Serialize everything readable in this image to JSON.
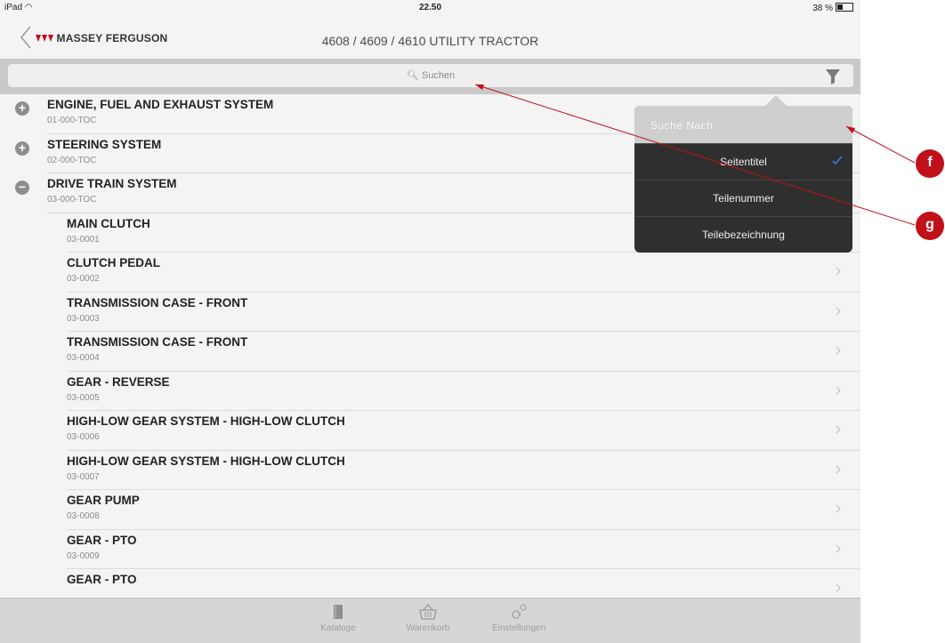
{
  "status_bar": {
    "device": "iPad",
    "time": "22.50",
    "battery": "38 %"
  },
  "nav": {
    "brand": "MASSEY FERGUSON",
    "title": "4608 / 4609 / 4610 UTILITY TRACTOR"
  },
  "search": {
    "placeholder": "Suchen"
  },
  "items": [
    {
      "title": "ENGINE, FUEL AND EXHAUST SYSTEM",
      "code": "01-000-TOC",
      "toggle": "+"
    },
    {
      "title": "STEERING SYSTEM",
      "code": "02-000-TOC",
      "toggle": "+"
    },
    {
      "title": "DRIVE TRAIN SYSTEM",
      "code": "03-000-TOC",
      "toggle": "−"
    },
    {
      "title": "MAIN CLUTCH",
      "code": "03-0001"
    },
    {
      "title": "CLUTCH PEDAL",
      "code": "03-0002"
    },
    {
      "title": "TRANSMISSION CASE - FRONT",
      "code": "03-0003"
    },
    {
      "title": "TRANSMISSION CASE - FRONT",
      "code": "03-0004"
    },
    {
      "title": "GEAR - REVERSE",
      "code": "03-0005"
    },
    {
      "title": "HIGH-LOW GEAR SYSTEM - HIGH-LOW CLUTCH",
      "code": "03-0006"
    },
    {
      "title": "HIGH-LOW GEAR SYSTEM - HIGH-LOW CLUTCH",
      "code": "03-0007"
    },
    {
      "title": "GEAR PUMP",
      "code": "03-0008"
    },
    {
      "title": "GEAR - PTO",
      "code": "03-0009"
    },
    {
      "title": "GEAR - PTO",
      "code": ""
    }
  ],
  "popover": {
    "header": "Suche Nach:",
    "options": [
      "Seitentitel",
      "Teilenummer",
      "Teilebezeichnung"
    ],
    "selected": "Seitentitel"
  },
  "tabbar": {
    "tabs": [
      "Kataloge",
      "Warenkorb",
      "Einstellungen"
    ]
  },
  "callouts": [
    "f",
    "g"
  ],
  "colors": {
    "accent": "#c0101a",
    "check": "#2f7de1",
    "popover_bg": "#2f2f2f"
  }
}
